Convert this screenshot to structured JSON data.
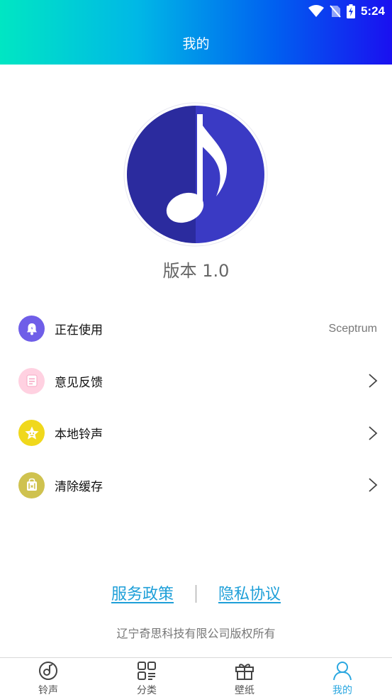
{
  "status_bar": {
    "time": "5:24"
  },
  "header": {
    "title": "我的"
  },
  "app_info": {
    "version": "版本 1.0"
  },
  "menu": {
    "items": [
      {
        "label": "正在使用",
        "value": "Sceptrum",
        "icon": "bell-icon",
        "color": "#6f5ee8"
      },
      {
        "label": "意见反馈",
        "icon": "note-icon",
        "color": "#ffd1e1"
      },
      {
        "label": "本地铃声",
        "icon": "star-icon",
        "color": "#f0d81c"
      },
      {
        "label": "清除缓存",
        "icon": "bag-icon",
        "color": "#cfc24f"
      }
    ]
  },
  "footer": {
    "service_link": "服务政策",
    "privacy_link": "隐私协议",
    "copyright": "辽宁奇思科技有限公司版权所有"
  },
  "tabbar": {
    "items": [
      {
        "label": "铃声",
        "icon": "music-disc-icon",
        "active": false
      },
      {
        "label": "分类",
        "icon": "grid-icon",
        "active": false
      },
      {
        "label": "壁纸",
        "icon": "gift-icon",
        "active": false
      },
      {
        "label": "我的",
        "icon": "person-icon",
        "active": true
      }
    ],
    "active_color": "#2aa7e0"
  },
  "colors": {
    "header_start": "#00e6c3",
    "header_end": "#1a10f0",
    "link": "#1e9fd8",
    "logo": "#3030b0"
  }
}
